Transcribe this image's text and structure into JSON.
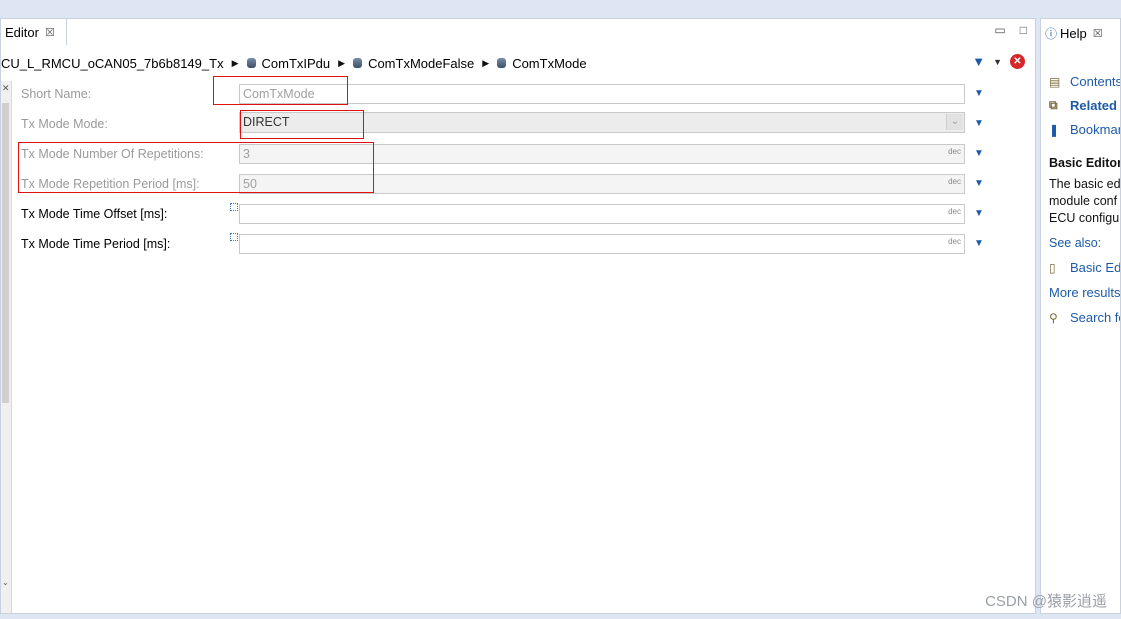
{
  "editor": {
    "tab_title": "Editor",
    "tab_close": "☒",
    "minimize": "▭",
    "maximize": "□"
  },
  "breadcrumb": {
    "items": [
      "CU_L_RMCU_oCAN05_7b6b8149_Tx",
      "ComTxIPdu",
      "ComTxModeFalse",
      "ComTxMode"
    ]
  },
  "toolbar": {
    "filter_icon": "filter-icon",
    "dropdown_icon": "chevron-down-icon",
    "stop_icon": "stop-icon"
  },
  "form": {
    "short_name": {
      "label": "Short Name:",
      "value": "ComTxMode"
    },
    "tx_mode_mode": {
      "label": "Tx Mode Mode:",
      "value": "DIRECT"
    },
    "tx_mode_repetitions": {
      "label": "Tx Mode Number Of Repetitions:",
      "value": "3",
      "suffix": "dec"
    },
    "tx_mode_rep_period": {
      "label": "Tx Mode Repetition Period [ms]:",
      "value": "50",
      "suffix": "dec"
    },
    "tx_mode_time_offset": {
      "label": "Tx Mode Time Offset [ms]:",
      "value": "",
      "suffix": "dec"
    },
    "tx_mode_time_period": {
      "label": "Tx Mode Time Period [ms]:",
      "value": "",
      "suffix": "dec"
    }
  },
  "help": {
    "tab_title": "Help",
    "tab_close": "☒",
    "links": {
      "contents": "Contents",
      "related": "Related T",
      "bookmarks": "Bookmar"
    },
    "section_title": "Basic Editor",
    "text_lines": [
      "The basic ed",
      "module conf",
      "ECU configu"
    ],
    "see_also": "See also:",
    "basic_editor_link": "Basic Edi",
    "more_results": "More results",
    "search_for": "Search fo"
  },
  "watermark": "CSDN @猿影逍遥",
  "colors": {
    "highlight": "#e01010",
    "accent": "#1e5aa8"
  }
}
